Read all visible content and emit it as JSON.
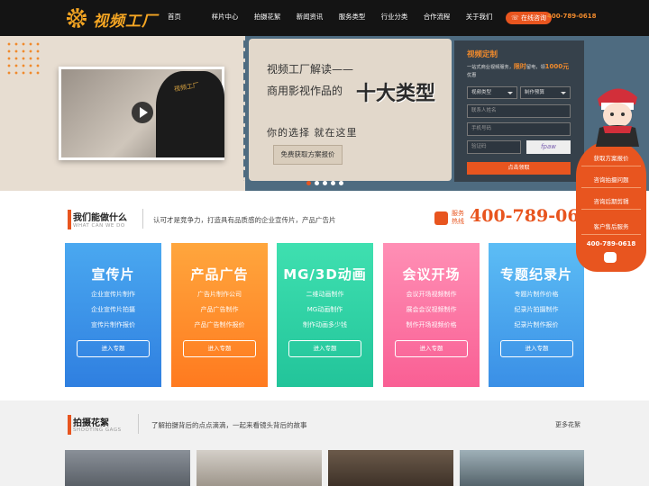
{
  "nav": {
    "logo_text": "视频工厂",
    "items": [
      "首页",
      "样片中心",
      "拍摄花絮",
      "新闻资讯",
      "服务类型",
      "行业分类",
      "合作流程",
      "关于我们"
    ],
    "online_label": "在线咨询",
    "phone": "400-789-0618"
  },
  "banner": {
    "line1": "视频工厂解读——",
    "line2_prefix": "商用影视作品的",
    "line2_big": "十大类型",
    "line3": "你的选择  就在这里",
    "quote_button": "免费获取方案报价",
    "video_badge": "视频工厂",
    "slide_count": 5,
    "active_slide": 0
  },
  "form": {
    "title": "视频定制",
    "subtitle_a": "一站式商业视频服务，",
    "subtitle_highlight": "限时",
    "subtitle_b": "留电，领",
    "subtitle_amount": "1000元",
    "subtitle_c": "优惠",
    "select_type": "视频类型",
    "select_budget": "制作预算",
    "contact_placeholder": "联系人姓名",
    "phone_placeholder": "手机号码",
    "code_placeholder": "验证码",
    "captcha": "fpaw",
    "submit": "点击领取"
  },
  "sidebar": {
    "items": [
      "获取方案报价",
      "咨询拍摄问题",
      "咨询后期剪辑",
      "客户售后服务"
    ],
    "phone": "400-789-0618"
  },
  "services": {
    "heading": "我们能做什么",
    "heading_en": "WHAT CAN WE DO",
    "slogan": "认可才是竞争力，打造具有品质感的企业宣传片，产品广告片",
    "hotline_label_1": "服务",
    "hotline_label_2": "热线",
    "hotline_number": "400-789-0618",
    "cards": [
      {
        "title": "宣传片",
        "lines": [
          "企业宣传片制作",
          "企业宣传片拍摄",
          "宣传片制作报价"
        ],
        "button": "进入专题",
        "color_top": "#4aa8f0",
        "color_bottom": "#2f7fe0"
      },
      {
        "title": "产品广告",
        "lines": [
          "广告片制作公司",
          "产品广告制作",
          "产品广告制作报价"
        ],
        "button": "进入专题",
        "color_top": "#ffa63d",
        "color_bottom": "#ff7a1f"
      },
      {
        "title": "MG/3D动画",
        "lines": [
          "二维动画制作",
          "MG动画制作",
          "制作动画多少钱"
        ],
        "button": "进入专题",
        "color_top": "#3fe0b0",
        "color_bottom": "#22c49a"
      },
      {
        "title": "会议开场",
        "lines": [
          "会议开场视频制作",
          "展会会议视频制作",
          "制作开场视频价格"
        ],
        "button": "进入专题",
        "color_top": "#ff8fb5",
        "color_bottom": "#f95f94"
      },
      {
        "title": "专题纪录片",
        "lines": [
          "专题片制作价格",
          "纪录片拍摄制作",
          "纪录片制作报价"
        ],
        "button": "进入专题",
        "color_top": "#5cbdf5",
        "color_bottom": "#3a8fe6"
      }
    ]
  },
  "shooting": {
    "heading": "拍摄花絮",
    "heading_en": "SHOOTING GAGS",
    "slogan": "了解拍摄背后的点点滴滴，一起来看镜头背后的故事",
    "more": "更多花絮"
  },
  "colors": {
    "accent": "#e8551f",
    "nav_bg": "#141414",
    "banner_panel": "#4e6b80"
  }
}
